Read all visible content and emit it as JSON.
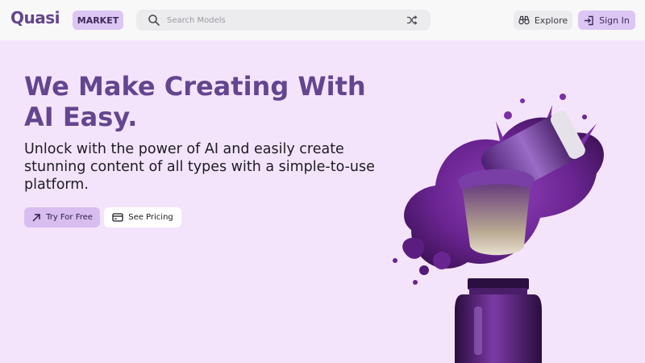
{
  "header": {
    "logo_text": "Quasi",
    "badge_label": "MARKET",
    "search": {
      "placeholder": "Search Models",
      "value": ""
    },
    "explore_label": "Explore",
    "signin_label": "Sign In"
  },
  "hero": {
    "title": "We Make Creating With AI Easy.",
    "subtitle": "Unlock with the power of AI and easily create stunning content of all types with a simple-to-use platform.",
    "primary_button": "Try For Free",
    "secondary_button": "See Pricing"
  },
  "colors": {
    "brand_purple": "#64458f",
    "accent_lilac": "#dcc6f3",
    "hero_background": "#f4e4fb"
  },
  "icons": [
    "search-icon",
    "shuffle-icon",
    "binoculars-icon",
    "sign-in-icon",
    "arrow-up-right-icon",
    "credit-card-icon"
  ]
}
